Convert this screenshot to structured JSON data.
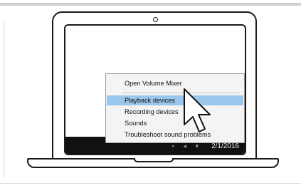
{
  "screen": {
    "tray_icons": "▪ ◂ ▾",
    "date": "2/1/2016"
  },
  "menu": {
    "items": [
      {
        "label": "Open Volume Mixer"
      },
      {
        "label": "Playback devices"
      },
      {
        "label": "Recording devices"
      },
      {
        "label": "Sounds"
      },
      {
        "label": "Troubleshoot sound problems"
      }
    ]
  },
  "colors": {
    "highlight": "#99c6ea",
    "taskbar": "#111111"
  },
  "icons": [
    "camera-icon",
    "mouse-cursor-icon",
    "tray-icons"
  ]
}
